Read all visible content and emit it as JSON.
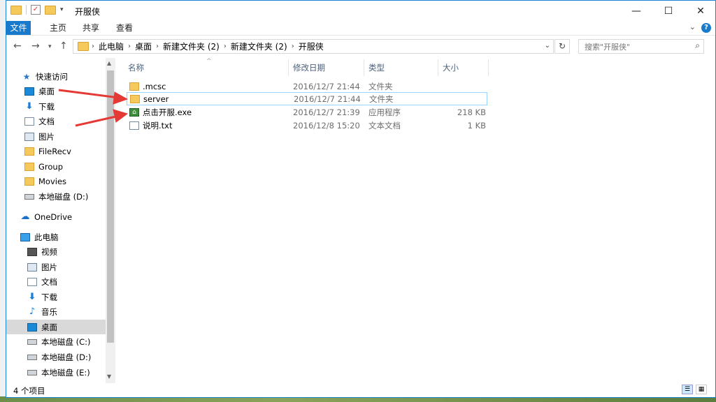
{
  "window": {
    "title": "开服侠"
  },
  "titlebar": {
    "minimize": "—",
    "maximize": "☐",
    "close": "✕"
  },
  "ribbon": {
    "tabs": [
      "文件",
      "主页",
      "共享",
      "查看"
    ],
    "help": "?"
  },
  "address": {
    "crumbs": [
      "此电脑",
      "桌面",
      "新建文件夹 (2)",
      "新建文件夹 (2)",
      "开服侠"
    ]
  },
  "search": {
    "placeholder": "搜索\"开服侠\""
  },
  "nav": {
    "quick_access": "快速访问",
    "quick_items": [
      "桌面",
      "下载",
      "文档",
      "图片",
      "FileRecv",
      "Group",
      "Movies",
      "本地磁盘 (D:)"
    ],
    "onedrive": "OneDrive",
    "this_pc": "此电脑",
    "pc_items": [
      "视频",
      "图片",
      "文档",
      "下载",
      "音乐",
      "桌面",
      "本地磁盘 (C:)",
      "本地磁盘 (D:)",
      "本地磁盘 (E:)"
    ]
  },
  "columns": {
    "name": "名称",
    "date": "修改日期",
    "type": "类型",
    "size": "大小"
  },
  "files": [
    {
      "name": ".mcsc",
      "date": "2016/12/7 21:44",
      "type": "文件夹",
      "size": "",
      "icon": "folder-icon"
    },
    {
      "name": "server",
      "date": "2016/12/7 21:44",
      "type": "文件夹",
      "size": "",
      "icon": "folder-icon"
    },
    {
      "name": "点击开服.exe",
      "date": "2016/12/7 21:39",
      "type": "应用程序",
      "size": "218 KB",
      "icon": "exe-icon"
    },
    {
      "name": "说明.txt",
      "date": "2016/12/8 15:20",
      "type": "文本文档",
      "size": "1 KB",
      "icon": "txt-icon"
    }
  ],
  "status": {
    "count": "4 个项目"
  },
  "colors": {
    "accent": "#1979ca",
    "annotation_arrow": "#e53935"
  }
}
